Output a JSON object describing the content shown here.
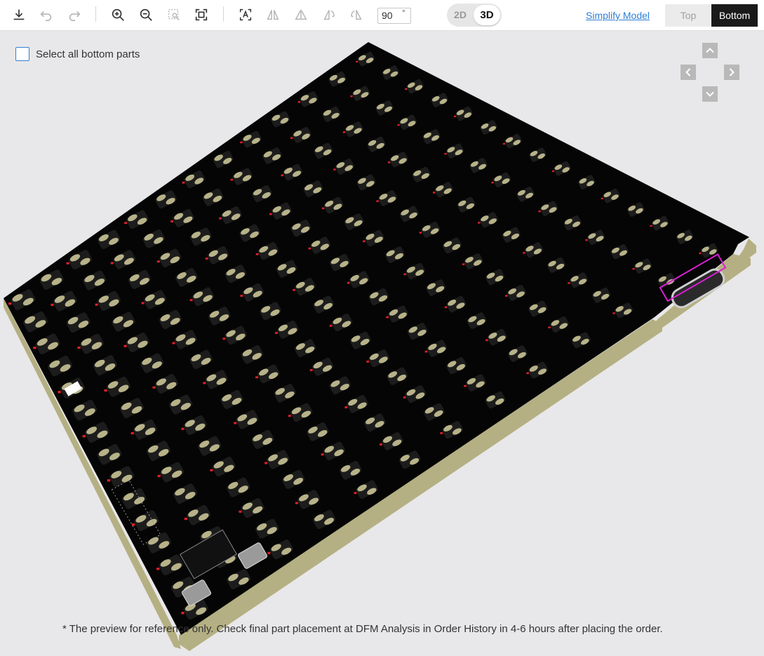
{
  "toolbar": {
    "icons": [
      "download-icon",
      "undo-icon",
      "redo-icon",
      "zoom-in-icon",
      "zoom-out-icon",
      "zoom-region-icon",
      "fit-view-icon",
      "text-icon",
      "flip-horizontal-icon",
      "flip-vertical-icon",
      "rotate-ccw-icon",
      "rotate-cw-icon"
    ],
    "rotation_value": "90",
    "rotation_unit": "°",
    "mode_2d": "2D",
    "mode_3d": "3D",
    "simplify_label": "Simplify Model",
    "side_top": "Top",
    "side_bottom": "Bottom"
  },
  "viewer": {
    "select_all_label": "Select all bottom parts",
    "nav_icons": [
      "arrow-up-icon",
      "arrow-left-icon",
      "arrow-right-icon",
      "arrow-down-icon"
    ],
    "footnote": "* The preview for reference only. Check final part placement at DFM Analysis in Order History in 4-6 hours after placing the order."
  },
  "colors": {
    "board_top": "#050505",
    "board_edge": "#b5b083",
    "pad": "#b7b289",
    "accent_link": "#2f7fd6",
    "active_side": "#1a1a1a",
    "highlight_part": "#d81fd2",
    "led_red": "#e0202a"
  }
}
